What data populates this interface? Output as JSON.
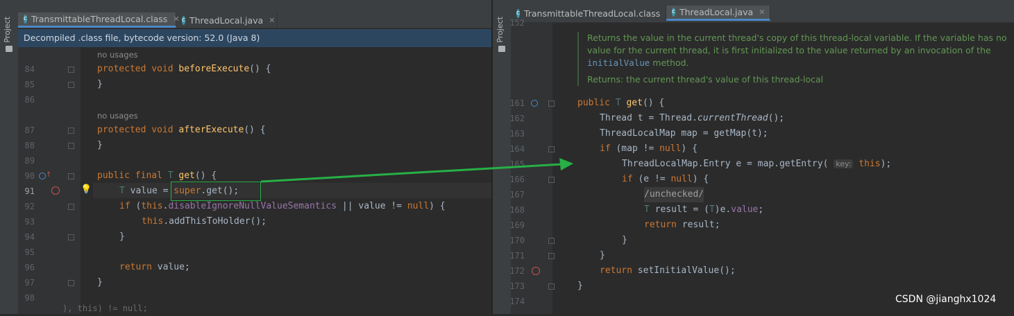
{
  "left_panel": {
    "sidebar_label": "Project",
    "tabs": [
      {
        "label": "TransmittableThreadLocal.class",
        "active": true
      },
      {
        "label": "ThreadLocal.java",
        "active": false
      }
    ],
    "banner": "Decompiled .class file, bytecode version: 52.0 (Java 8)",
    "usages_1": "no usages",
    "usages_2": "no usages",
    "lines": [
      {
        "n": "84",
        "code": "protected void beforeExecute() {"
      },
      {
        "n": "85",
        "code": "}"
      },
      {
        "n": "86",
        "code": ""
      },
      {
        "n": "87",
        "code": "protected void afterExecute() {"
      },
      {
        "n": "88",
        "code": "}"
      },
      {
        "n": "89",
        "code": ""
      },
      {
        "n": "90",
        "code": "public final T get() {"
      },
      {
        "n": "91",
        "code": "T value = super.get();"
      },
      {
        "n": "92",
        "code": "if (this.disableIgnoreNullValueSemantics || value != null) {"
      },
      {
        "n": "93",
        "code": "this.addThisToHolder();"
      },
      {
        "n": "94",
        "code": "}"
      },
      {
        "n": "95",
        "code": ""
      },
      {
        "n": "96",
        "code": "return value;"
      },
      {
        "n": "97",
        "code": "}"
      },
      {
        "n": "98",
        "code": ""
      }
    ],
    "bottom_fragment": "), this) != null;"
  },
  "right_panel": {
    "sidebar_label": "Project",
    "tabs": [
      {
        "label": "TransmittableThreadLocal.class",
        "active": false
      },
      {
        "label": "ThreadLocal.java",
        "active": true
      }
    ],
    "top_partial_number": "152",
    "doc_text_1": "Returns the value in the current thread's copy of this thread-local variable. If the variable has no value for the current thread, it is first initialized to the value returned by an invocation of the",
    "doc_code": "initialValue",
    "doc_text_2": "method.",
    "doc_returns": "Returns: the current thread's value of this thread-local",
    "param_hint": "key:",
    "lines": [
      {
        "n": "161",
        "code": "public T get() {"
      },
      {
        "n": "162",
        "code": "Thread t = Thread.currentThread();"
      },
      {
        "n": "163",
        "code": "ThreadLocalMap map = getMap(t);"
      },
      {
        "n": "164",
        "code": "if (map != null) {"
      },
      {
        "n": "165",
        "code": "ThreadLocalMap.Entry e = map.getEntry(this);"
      },
      {
        "n": "166",
        "code": "if (e != null) {"
      },
      {
        "n": "167",
        "code": "/unchecked/"
      },
      {
        "n": "168",
        "code": "T result = (T)e.value;"
      },
      {
        "n": "169",
        "code": "return result;"
      },
      {
        "n": "170",
        "code": "}"
      },
      {
        "n": "171",
        "code": "}"
      },
      {
        "n": "172",
        "code": "return setInitialValue();"
      },
      {
        "n": "173",
        "code": "}"
      },
      {
        "n": "174",
        "code": ""
      }
    ]
  },
  "watermark": "CSDN @jianghx1024",
  "colors": {
    "keyword": "#cc7832",
    "function": "#ffc66d",
    "doc": "#629755",
    "arrow": "#27b046",
    "selection_box": "#27b046"
  }
}
